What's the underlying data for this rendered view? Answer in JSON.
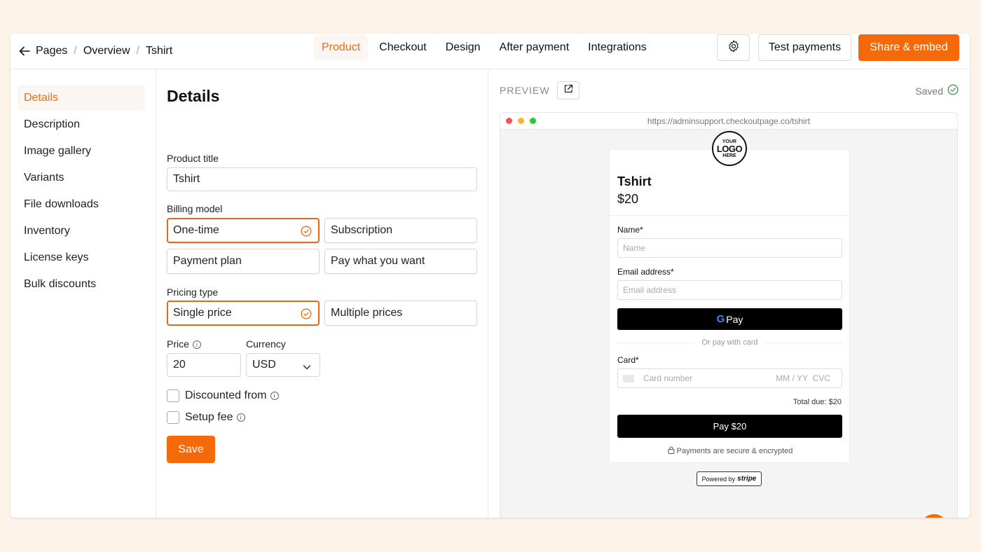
{
  "breadcrumb": [
    "Pages",
    "Overview",
    "Tshirt"
  ],
  "tabs": [
    "Product",
    "Checkout",
    "Design",
    "After payment",
    "Integrations"
  ],
  "active_tab": "Product",
  "buttons": {
    "test_payments": "Test payments",
    "share_embed": "Share & embed",
    "save": "Save"
  },
  "sidebar": {
    "items": [
      "Details",
      "Description",
      "Image gallery",
      "Variants",
      "File downloads",
      "Inventory",
      "License keys",
      "Bulk discounts"
    ],
    "active": "Details"
  },
  "form": {
    "heading": "Details",
    "product_title_label": "Product title",
    "product_title_value": "Tshirt",
    "billing_model_label": "Billing model",
    "billing_options": [
      "One-time",
      "Subscription",
      "Payment plan",
      "Pay what you want"
    ],
    "billing_selected": "One-time",
    "pricing_type_label": "Pricing type",
    "pricing_options": [
      "Single price",
      "Multiple prices"
    ],
    "pricing_selected": "Single price",
    "price_label": "Price",
    "price_value": "20",
    "currency_label": "Currency",
    "currency_value": "USD",
    "discounted_from_label": "Discounted from",
    "setup_fee_label": "Setup fee"
  },
  "preview": {
    "label": "PREVIEW",
    "saved": "Saved",
    "url": "https://adminsupport.checkoutpage.co/tshirt",
    "logo": [
      "YOUR",
      "LOGO",
      "HERE"
    ],
    "product_title": "Tshirt",
    "price": "$20",
    "name_label": "Name",
    "name_placeholder": "Name",
    "email_label": "Email address",
    "email_placeholder": "Email address",
    "gpay_label": "Pay",
    "or_text": "Or pay with card",
    "card_label": "Card",
    "card_number_placeholder": "Card number",
    "card_expiry_placeholder": "MM / YY",
    "card_cvc_placeholder": "CVC",
    "total_due": "Total due: $20",
    "pay_button": "Pay $20",
    "secure_text": "Payments are secure & encrypted",
    "powered_by": "Powered by",
    "stripe": "stripe"
  },
  "colors": {
    "accent": "#f46a0a",
    "background": "#fdf3e9"
  }
}
